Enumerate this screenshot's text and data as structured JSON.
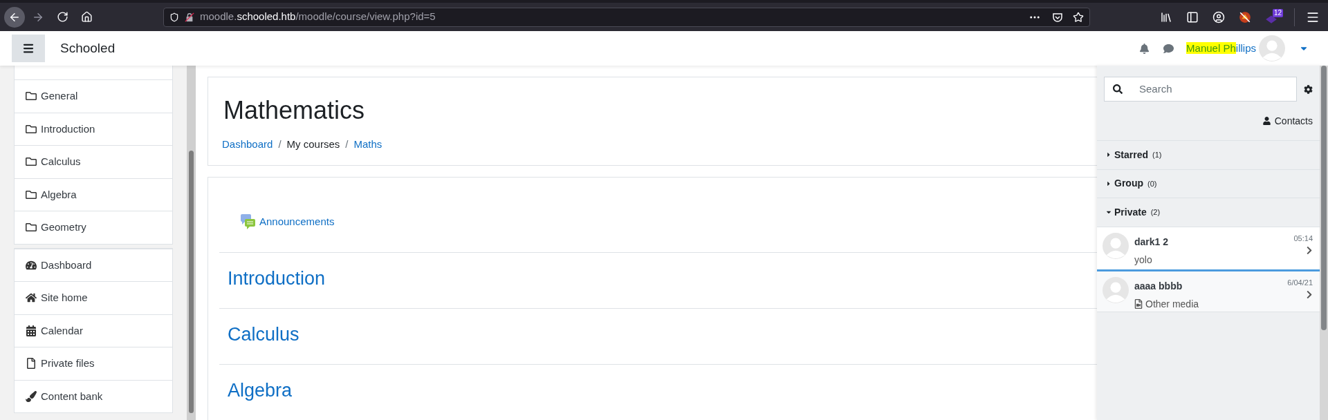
{
  "browser": {
    "url_prefix": "moodle.",
    "url_host": "schooled.htb",
    "url_path": "/moodle/course/view.php?id=5",
    "extension_badge": "12"
  },
  "navbar": {
    "site_name": "Schooled",
    "user_name_highlighted": "Manuel Ph",
    "user_name_rest": "illips"
  },
  "nav_groups": [
    [
      {
        "label": "General",
        "kind": "folder"
      },
      {
        "label": "Introduction",
        "kind": "folder"
      },
      {
        "label": "Calculus",
        "kind": "folder"
      },
      {
        "label": "Algebra",
        "kind": "folder"
      },
      {
        "label": "Geometry",
        "kind": "folder"
      }
    ],
    [
      {
        "label": "Dashboard",
        "kind": "dashboard"
      },
      {
        "label": "Site home",
        "kind": "home"
      },
      {
        "label": "Calendar",
        "kind": "calendar"
      },
      {
        "label": "Private files",
        "kind": "file"
      },
      {
        "label": "Content bank",
        "kind": "brush"
      }
    ]
  ],
  "course": {
    "title": "Mathematics",
    "separator": "/",
    "breadcrumb": [
      {
        "label": "Dashboard",
        "link": true
      },
      {
        "label": "My courses",
        "link": false
      },
      {
        "label": "Maths",
        "link": true
      }
    ]
  },
  "activities": [
    {
      "label": "Announcements"
    }
  ],
  "sections": [
    {
      "title": "Introduction"
    },
    {
      "title": "Calculus"
    },
    {
      "title": "Algebra"
    }
  ],
  "messages": {
    "search_placeholder": "Search",
    "contacts_label": "Contacts",
    "groups": [
      {
        "label": "Starred",
        "count": "(1)",
        "expanded": false
      },
      {
        "label": "Group",
        "count": "(0)",
        "expanded": false
      },
      {
        "label": "Private",
        "count": "(2)",
        "expanded": true
      }
    ],
    "conversations": [
      {
        "name": "dark1 2",
        "time": "05:14",
        "preview": "yolo",
        "kind": "text",
        "selected": false
      },
      {
        "name": "aaaa bbbb",
        "time": "6/04/21",
        "preview": "Other media",
        "kind": "media",
        "selected": true
      }
    ]
  }
}
